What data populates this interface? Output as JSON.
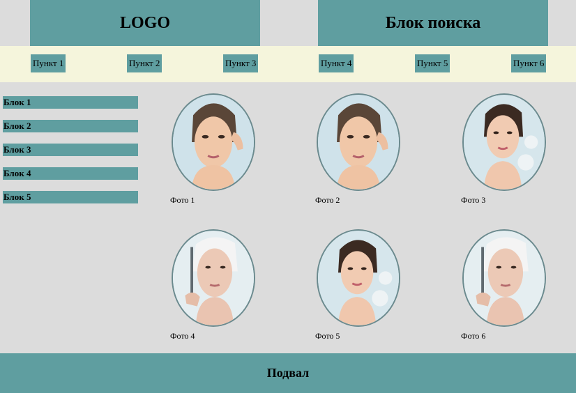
{
  "header": {
    "logo_text": "LOGO",
    "search_text": "Блок поиска"
  },
  "nav": {
    "items": [
      {
        "label": "Пункт 1"
      },
      {
        "label": "Пункт 2"
      },
      {
        "label": "Пункт 3"
      },
      {
        "label": "Пункт 4"
      },
      {
        "label": "Пункт 5"
      },
      {
        "label": "Пункт 6"
      }
    ]
  },
  "sidebar": {
    "items": [
      {
        "label": "Блок 1"
      },
      {
        "label": "Блок 2"
      },
      {
        "label": "Блок 3"
      },
      {
        "label": "Блок 4"
      },
      {
        "label": "Блок 5"
      }
    ]
  },
  "gallery": {
    "photos": [
      {
        "caption": "Фото 1"
      },
      {
        "caption": "Фото 2"
      },
      {
        "caption": "Фото 3"
      },
      {
        "caption": "Фото 4"
      },
      {
        "caption": "Фото 5"
      },
      {
        "caption": "Фото 6"
      }
    ]
  },
  "footer": {
    "text": "Подвал"
  },
  "colors": {
    "accent": "#5f9ea0",
    "nav_background": "#f5f5dc",
    "page_background": "#dcdcdc"
  }
}
